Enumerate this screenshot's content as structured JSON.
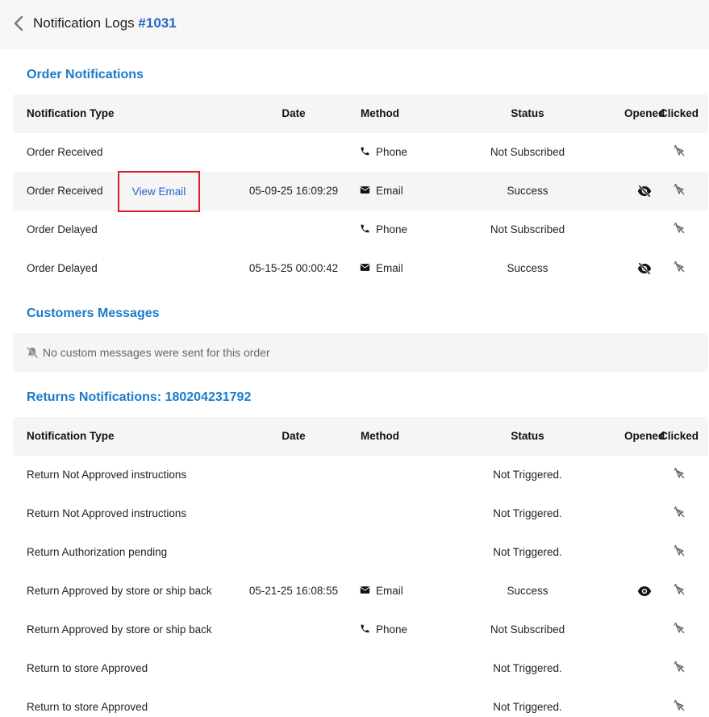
{
  "header": {
    "title": "Notification Logs",
    "order_number": "#1031"
  },
  "order_section": {
    "title": "Order Notifications",
    "view_email_label": "View Email",
    "columns": [
      "Notification Type",
      "Date",
      "Method",
      "Status",
      "Opened",
      "Clicked"
    ],
    "rows": [
      {
        "type": "Order Received",
        "date": "",
        "method": "Phone",
        "method_icon": "phone-icon",
        "status": "Not Subscribed",
        "opened_icon": "",
        "clicked_icon": "cursor-off-icon"
      },
      {
        "type": "Order Received",
        "date": "05-09-25 16:09:29",
        "method": "Email",
        "method_icon": "envelope-icon",
        "status": "Success",
        "opened_icon": "eye-off-icon",
        "clicked_icon": "cursor-off-icon"
      },
      {
        "type": "Order Delayed",
        "date": "",
        "method": "Phone",
        "method_icon": "phone-icon",
        "status": "Not Subscribed",
        "opened_icon": "",
        "clicked_icon": "cursor-off-icon"
      },
      {
        "type": "Order Delayed",
        "date": "05-15-25 00:00:42",
        "method": "Email",
        "method_icon": "envelope-icon",
        "status": "Success",
        "opened_icon": "eye-off-icon",
        "clicked_icon": "cursor-off-icon"
      }
    ]
  },
  "customers_section": {
    "title": "Customers Messages",
    "empty_icon": "bell-off-icon",
    "empty_message": "No custom messages were sent for this order"
  },
  "returns_section": {
    "title": "Returns Notifications: 180204231792",
    "columns": [
      "Notification Type",
      "Date",
      "Method",
      "Status",
      "Opened",
      "Clicked"
    ],
    "rows": [
      {
        "type": "Return Not Approved instructions",
        "date": "",
        "method": "",
        "method_icon": "",
        "status": "Not Triggered.",
        "opened_icon": "",
        "clicked_icon": "cursor-off-icon"
      },
      {
        "type": "Return Not Approved instructions",
        "date": "",
        "method": "",
        "method_icon": "",
        "status": "Not Triggered.",
        "opened_icon": "",
        "clicked_icon": "cursor-off-icon"
      },
      {
        "type": "Return Authorization pending",
        "date": "",
        "method": "",
        "method_icon": "",
        "status": "Not Triggered.",
        "opened_icon": "",
        "clicked_icon": "cursor-off-icon"
      },
      {
        "type": "Return Approved by store or ship back",
        "date": "05-21-25 16:08:55",
        "method": "Email",
        "method_icon": "envelope-icon",
        "status": "Success",
        "opened_icon": "eye-icon",
        "clicked_icon": "cursor-off-icon"
      },
      {
        "type": "Return Approved by store or ship back",
        "date": "",
        "method": "Phone",
        "method_icon": "phone-icon",
        "status": "Not Subscribed",
        "opened_icon": "",
        "clicked_icon": "cursor-off-icon"
      },
      {
        "type": "Return to store Approved",
        "date": "",
        "method": "",
        "method_icon": "",
        "status": "Not Triggered.",
        "opened_icon": "",
        "clicked_icon": "cursor-off-icon"
      },
      {
        "type": "Return to store Approved",
        "date": "",
        "method": "",
        "method_icon": "",
        "status": "Not Triggered.",
        "opened_icon": "",
        "clicked_icon": "cursor-off-icon"
      }
    ]
  }
}
